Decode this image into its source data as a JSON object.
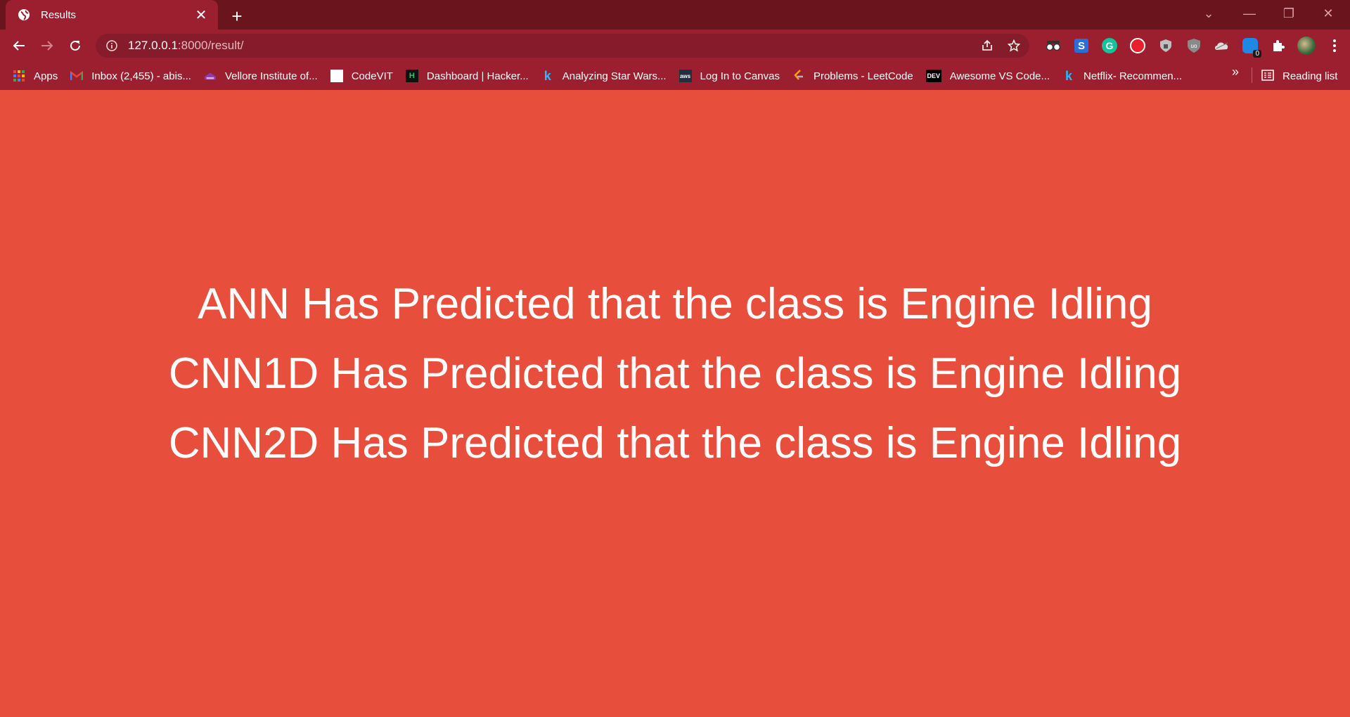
{
  "browser": {
    "tab": {
      "title": "Results",
      "favicon": "globe-icon"
    },
    "url": {
      "host": "127.0.0.1",
      "path": ":8000/result/"
    },
    "colors": {
      "frame": "#6a141d",
      "toolbar": "#9c1f2f",
      "page_bg": "#e84e3c"
    }
  },
  "bookmarks": [
    {
      "label": "Apps",
      "icon": "apps-grid-icon"
    },
    {
      "label": "Inbox (2,455) - abis...",
      "icon": "gmail-icon"
    },
    {
      "label": "Vellore Institute of...",
      "icon": "vit-icon"
    },
    {
      "label": "CodeVIT",
      "icon": "codevit-icon"
    },
    {
      "label": "Dashboard | Hacker...",
      "icon": "hackerrank-icon"
    },
    {
      "label": "Analyzing Star Wars...",
      "icon": "kaggle-icon"
    },
    {
      "label": "Log In to Canvas",
      "icon": "aws-icon"
    },
    {
      "label": "Problems - LeetCode",
      "icon": "leetcode-icon"
    },
    {
      "label": "Awesome VS Code...",
      "icon": "dev-icon"
    },
    {
      "label": "Netflix- Recommen...",
      "icon": "kaggle-icon"
    }
  ],
  "reading_list": "Reading list",
  "extensions_badge": "0",
  "page": {
    "lines": [
      "ANN Has Predicted that the class is Engine Idling",
      "CNN1D Has Predicted that the class is Engine Idling",
      "CNN2D Has Predicted that the class is Engine Idling"
    ]
  }
}
